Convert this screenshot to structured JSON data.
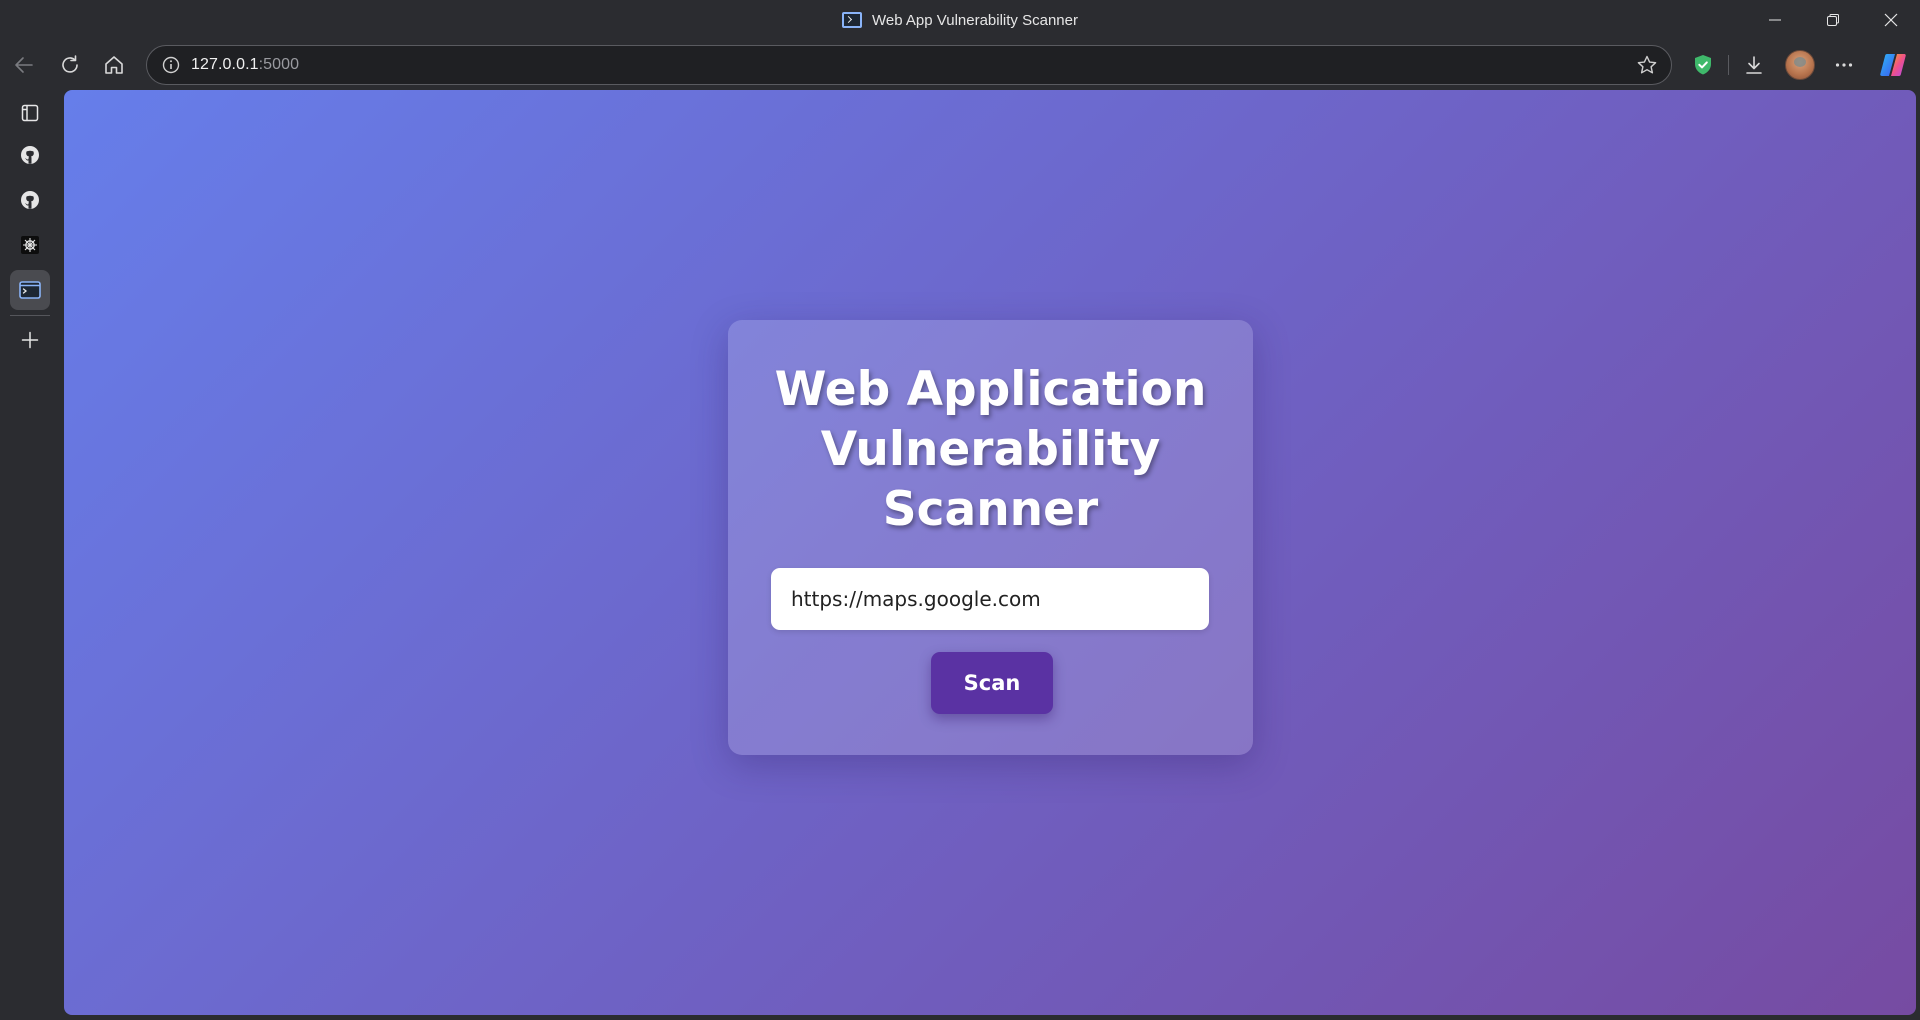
{
  "window": {
    "title": "Web App Vulnerability Scanner",
    "tab_icon": "terminal-window-icon",
    "controls": [
      "minimize-icon",
      "restore-icon",
      "close-icon"
    ]
  },
  "toolbar": {
    "buttons": [
      "back-arrow-icon",
      "reload-icon",
      "home-icon"
    ],
    "address": {
      "host": "127.0.0.1",
      "port": ":5000",
      "info_icon": "info-icon",
      "favorite_icon": "star-icon"
    },
    "right_icons": [
      "shield-check-icon",
      "download-icon",
      "profile-avatar",
      "more-icon",
      "copilot-icon"
    ]
  },
  "sidebar": {
    "items": [
      {
        "name": "sidebar-tab-actions",
        "icon": "tab-actions-icon"
      },
      {
        "name": "sidebar-github-1",
        "icon": "github-icon"
      },
      {
        "name": "sidebar-github-2",
        "icon": "github-icon"
      },
      {
        "name": "sidebar-app",
        "icon": "app-icon"
      },
      {
        "name": "sidebar-current-tab",
        "icon": "terminal-window-icon",
        "active": true
      }
    ],
    "add_icon": "plus-icon"
  },
  "page": {
    "heading": "Web Application Vulnerability Scanner",
    "url_input_value": "https://maps.google.com",
    "scan_button_label": "Scan",
    "background_gradient": [
      "#667eea",
      "#764ba2"
    ],
    "button_color": "#5a32a3"
  }
}
